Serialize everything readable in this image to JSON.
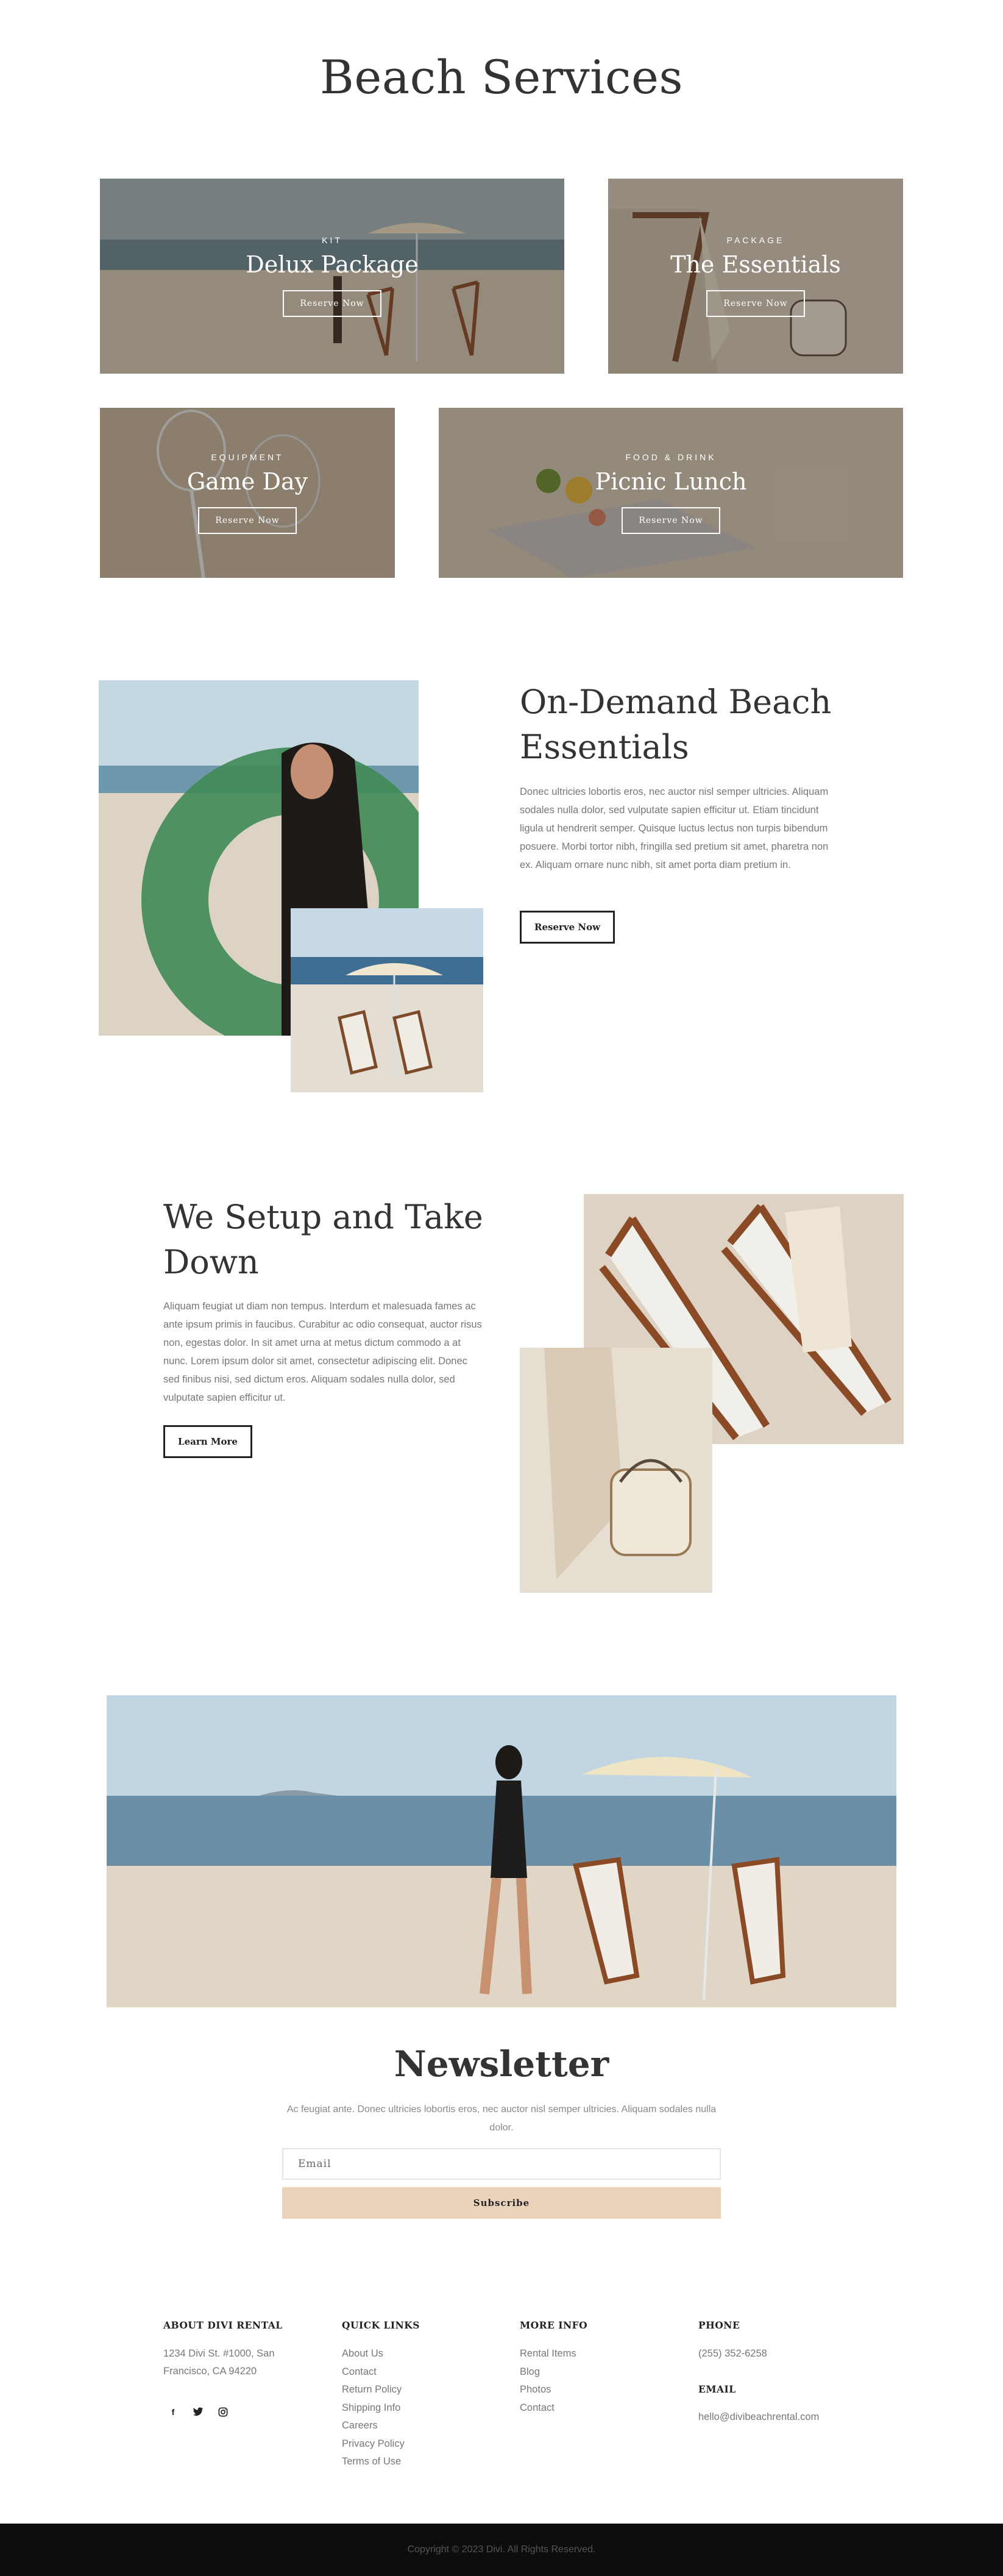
{
  "page": {
    "title": "Beach Services"
  },
  "services": [
    {
      "tag": "KIT",
      "name": "Delux Package",
      "button": "Reserve Now"
    },
    {
      "tag": "PACKAGE",
      "name": "The Essentials",
      "button": "Reserve Now"
    },
    {
      "tag": "EQUIPMENT",
      "name": "Game Day",
      "button": "Reserve Now"
    },
    {
      "tag": "FOOD & DRINK",
      "name": "Picnic Lunch",
      "button": "Reserve Now"
    }
  ],
  "on_demand": {
    "heading": "On-Demand Beach Essentials",
    "text": "Donec ultricies lobortis eros, nec auctor nisl semper ultricies. Aliquam sodales nulla dolor, sed vulputate sapien efficitur ut. Etiam tincidunt ligula ut hendrerit semper. Quisque luctus lectus non turpis bibendum posuere. Morbi tortor nibh, fringilla sed pretium sit amet, pharetra non ex. Aliquam ornare nunc nibh, sit amet porta diam pretium in.",
    "button": "Reserve Now"
  },
  "setup": {
    "heading": "We Setup and Take Down",
    "text": "Aliquam feugiat ut diam non tempus. Interdum et malesuada fames ac ante ipsum primis in faucibus. Curabitur ac odio consequat, auctor risus non, egestas dolor. In sit amet urna at metus dictum commodo a at nunc. Lorem ipsum dolor sit amet, consectetur adipiscing elit. Donec sed finibus nisi, sed dictum eros. Aliquam sodales nulla dolor, sed vulputate sapien efficitur ut.",
    "button": "Learn More"
  },
  "newsletter": {
    "title": "Newsletter",
    "text": "Ac feugiat ante. Donec ultricies lobortis eros, nec auctor nisl semper ultricies. Aliquam sodales nulla dolor.",
    "email_placeholder": "Email",
    "button": "Subscribe"
  },
  "footer": {
    "about": {
      "heading": "ABOUT DIVI RENTAL",
      "address_line1": "1234 Divi St. #1000, San",
      "address_line2": "Francisco, CA 94220"
    },
    "social_icons": [
      "facebook-icon",
      "twitter-icon",
      "instagram-icon"
    ],
    "quick_links": {
      "heading": "QUICK LINKS",
      "items": [
        "About Us",
        "Contact",
        "Return Policy",
        "Shipping Info",
        "Careers",
        "Privacy Policy",
        "Terms of Use"
      ]
    },
    "more_info": {
      "heading": "MORE INFO",
      "items": [
        "Rental Items",
        "Blog",
        "Photos",
        "Contact"
      ]
    },
    "phone": {
      "heading": "PHONE",
      "value": "(255) 352-6258"
    },
    "email": {
      "heading": "EMAIL",
      "value": "hello@divibeachrental.com"
    },
    "copyright": "Copyright © 2023 Divi. All Rights Reserved."
  },
  "colors": {
    "accent": "#ebd3bb",
    "bottom_bar": "#0d0d0d",
    "heading": "#333333"
  }
}
